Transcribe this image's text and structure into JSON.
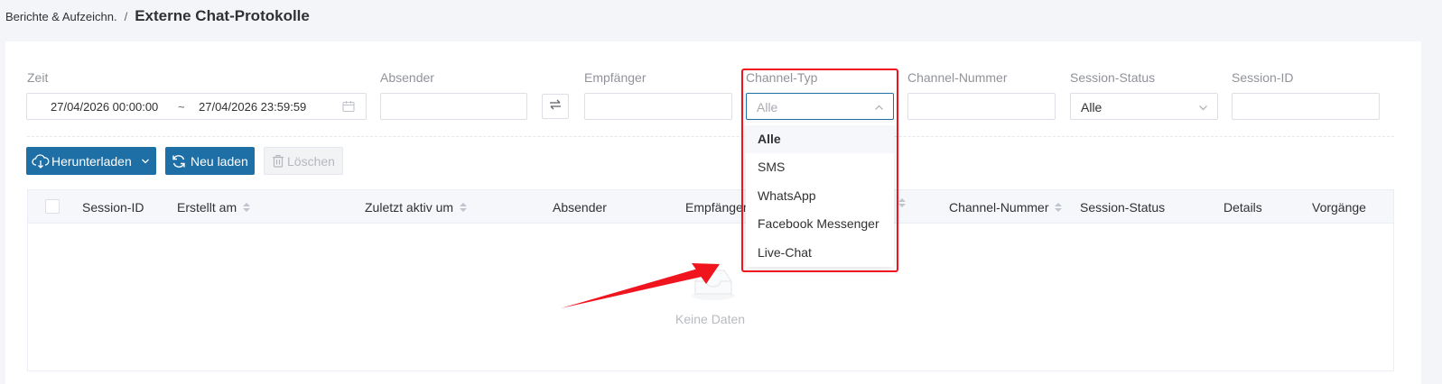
{
  "breadcrumb": {
    "parent": "Berichte & Aufzeichn.",
    "separator": "/",
    "current": "Externe Chat-Protokolle"
  },
  "filters": {
    "zeit": {
      "label": "Zeit",
      "start": "27/04/2026 00:00:00",
      "separator": "~",
      "end": "27/04/2026 23:59:59",
      "icon": "calendar-icon"
    },
    "absender": {
      "label": "Absender",
      "value": ""
    },
    "swap_icon": "swap-icon",
    "empfaenger": {
      "label": "Empfänger",
      "value": ""
    },
    "channel_typ": {
      "label": "Channel-Typ",
      "selected": "Alle",
      "expanded": true
    },
    "channel_nummer": {
      "label": "Channel-Nummer",
      "value": ""
    },
    "session_status": {
      "label": "Session-Status",
      "selected": "Alle"
    },
    "session_id": {
      "label": "Session-ID",
      "value": ""
    }
  },
  "dropdown": {
    "options": [
      "Alle",
      "SMS",
      "WhatsApp",
      "Facebook Messenger",
      "Live-Chat"
    ],
    "selected_index": 0
  },
  "toolbar": {
    "download_label": "Herunterladen",
    "reload_label": "Neu laden",
    "delete_label": "Löschen"
  },
  "table": {
    "columns": [
      "Session-ID",
      "Erstellt am",
      "Zuletzt aktiv um",
      "Absender",
      "Empfänger",
      "Channel-Nummer",
      "Session-Status",
      "Details",
      "Vorgänge"
    ],
    "rows": [],
    "empty_text": "Keine Daten"
  },
  "colors": {
    "primary": "#1d6fa6",
    "highlight": "#f0141e",
    "annotation_arrow": "#f0141e"
  }
}
